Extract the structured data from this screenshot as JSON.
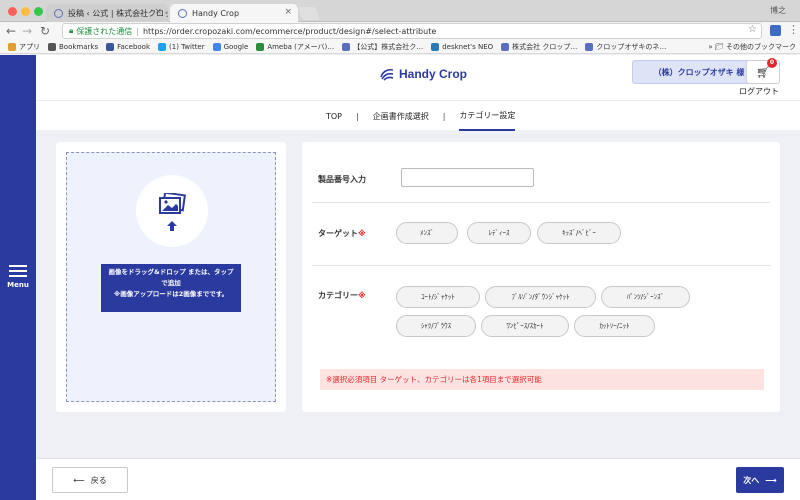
{
  "browser": {
    "tabs": [
      {
        "title": "投稿 ‹ 公式 | 株式会社クロップ…"
      },
      {
        "title": "Handy Crop"
      }
    ],
    "user_name": "博之",
    "address": {
      "secure_label": "保護された通信",
      "url": "https://order.cropozaki.com/ecommerce/product/design#/select-attribute"
    },
    "bookmarks": [
      {
        "label": "アプリ",
        "icon": "apps-grid-icon",
        "color": "#e0a030"
      },
      {
        "label": "Bookmarks",
        "icon": "star-icon",
        "color": "#555555"
      },
      {
        "label": "Facebook",
        "icon": "facebook-icon",
        "color": "#3b5998"
      },
      {
        "label": "(1) Twitter",
        "icon": "twitter-icon",
        "color": "#1da1f2"
      },
      {
        "label": "Google",
        "icon": "google-icon",
        "color": "#4285f4"
      },
      {
        "label": "Ameba (アメーバ)…",
        "icon": "ameba-icon",
        "color": "#2d8c3c"
      },
      {
        "label": "【公式】株式会社ク…",
        "icon": "site-icon",
        "color": "#5b6fc2"
      },
      {
        "label": "desknet's NEO",
        "icon": "desknets-icon",
        "color": "#2a7ab8"
      },
      {
        "label": "株式会社 クロップ…",
        "icon": "site-icon",
        "color": "#5b6fc2"
      },
      {
        "label": "クロップオザキのネ…",
        "icon": "site-icon",
        "color": "#5b6fc2"
      }
    ],
    "other_bookmarks": "その他のブックマーク"
  },
  "sidebar": {
    "menu_label": "Menu"
  },
  "header": {
    "logo_text": "Handy Crop",
    "company": "（株）クロップオザキ 様",
    "cart_count": "0",
    "logout": "ログアウト"
  },
  "breadcrumb": {
    "items": [
      "TOP",
      "企画書作成選択",
      "カテゴリー設定"
    ],
    "separator": "|"
  },
  "upload": {
    "line1": "画像をドラッグ&ドロップ または、タップ",
    "line2": "で追加",
    "line3": "※画像アップロードは2画像までです。"
  },
  "form": {
    "product_number_label": "製品番号入力",
    "product_number_value": "",
    "target_label": "ターゲット",
    "required_mark": "※",
    "targets": [
      "ﾒﾝｽﾞ",
      "ﾚﾃﾞｨｰｽ",
      "ｷｯｽﾞ/ﾍﾞﾋﾞｰ"
    ],
    "category_label": "カテゴリー",
    "categories": [
      "ｺｰﾄ/ｼﾞｬｹｯﾄ",
      "ﾌﾞﾙｿﾞﾝ/ﾀﾞｳﾝｼﾞｬｹｯﾄ",
      "ﾊﾟﾝﾂ/ｼﾞｰﾝｽﾞ",
      "ｼｬﾂ/ﾌﾞﾗｳｽ",
      "ﾜﾝﾋﾟｰｽ/ｽｶｰﾄ",
      "ｶｯﾄｿｰ/ﾆｯﾄ"
    ],
    "notice": "※選択必須項目 ターゲット、カテゴリーは各1項目まで選択可能"
  },
  "footer": {
    "back_label": "戻る",
    "next_label": "次へ"
  },
  "colors": {
    "brand": "#2b3a9e",
    "required": "#e02a2a",
    "notice_bg": "#fde2e2"
  }
}
